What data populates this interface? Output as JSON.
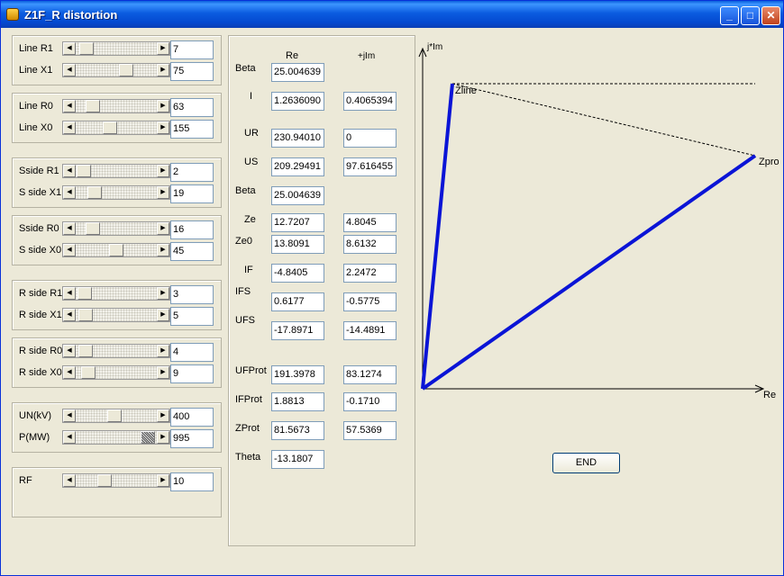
{
  "window": {
    "title": "Z1F_R distortion"
  },
  "sliders": [
    {
      "label": "Line R1",
      "value": "7",
      "pos": 0.05
    },
    {
      "label": "Line X1",
      "value": "75",
      "pos": 0.65
    },
    {
      "label": "Line R0",
      "value": "63",
      "pos": 0.15
    },
    {
      "label": "Line X0",
      "value": "155",
      "pos": 0.4
    },
    {
      "label": "Sside R1",
      "value": "2",
      "pos": 0.02
    },
    {
      "label": "S side X1",
      "value": "19",
      "pos": 0.17
    },
    {
      "label": "Sside R0",
      "value": "16",
      "pos": 0.15
    },
    {
      "label": "S side X0",
      "value": "45",
      "pos": 0.5
    },
    {
      "label": "R side R1",
      "value": "3",
      "pos": 0.03
    },
    {
      "label": "R side X1",
      "value": "5",
      "pos": 0.04
    },
    {
      "label": "R side R0",
      "value": "4",
      "pos": 0.04
    },
    {
      "label": "R side X0",
      "value": "9",
      "pos": 0.08
    },
    {
      "label": "UN(kV)",
      "value": "400",
      "pos": 0.47
    },
    {
      "label": "P(MW)",
      "value": "995",
      "pos": 0.97
    },
    {
      "label": "RF",
      "value": "10",
      "pos": 0.33
    }
  ],
  "results": {
    "col_re": "Re",
    "col_im": "+jIm",
    "rows": [
      {
        "label": "Beta",
        "re": "25.004639",
        "im": null
      },
      {
        "label": "I",
        "re": "1.2636090",
        "im": "0.4065394"
      },
      {
        "label": "UR",
        "re": "230.94010",
        "im": "0"
      },
      {
        "label": "US",
        "re": "209.29491",
        "im": "97.616455"
      },
      {
        "label": "Beta",
        "re": "25.004639",
        "im": null
      },
      {
        "label": "Ze",
        "re": "12.7207",
        "im": "4.8045"
      },
      {
        "label": "Ze0",
        "re": "13.8091",
        "im": "8.6132"
      },
      {
        "label": "IF",
        "re": "-4.8405",
        "im": "2.2472"
      },
      {
        "label": "IFS",
        "re": "0.6177",
        "im": "-0.5775"
      },
      {
        "label": "UFS",
        "re": "-17.8971",
        "im": "-14.4891"
      },
      {
        "label": "UFProt",
        "re": "191.3978",
        "im": "83.1274"
      },
      {
        "label": "IFProt",
        "re": "1.8813",
        "im": "-0.1710"
      },
      {
        "label": "ZProt",
        "re": "81.5673",
        "im": "57.5369"
      },
      {
        "label": "Theta",
        "re": "-13.1807",
        "im": null
      }
    ]
  },
  "plot": {
    "y_axis_label": "j*Im",
    "x_axis_label": "Re",
    "zline_label": "Zline",
    "zprot_label": "Zprot",
    "line_color": "#0a14d6"
  },
  "end_button": "END"
}
